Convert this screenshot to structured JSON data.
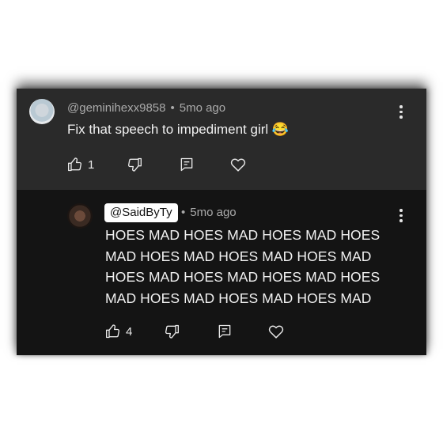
{
  "parent_comment": {
    "author": "@geminihexx9858",
    "separator": "•",
    "time": "5mo ago",
    "text": "Fix that speech to impediment girl 😂",
    "like_count": "1"
  },
  "reply": {
    "mention": "@SaidByTy",
    "separator": "•",
    "time": "5mo ago",
    "text": "HOES MAD HOES MAD HOES MAD HOES MAD HOES MAD HOES MAD HOES MAD HOES MAD HOES MAD HOES MAD HOES MAD HOES MAD HOES MAD HOES MAD",
    "like_count": "4"
  },
  "icons": [
    "like-icon",
    "dislike-icon",
    "reply-icon",
    "heart-icon",
    "more-vert-icon"
  ],
  "colors": {
    "parent_bg": "#2a2a2a",
    "reply_bg": "#141414",
    "text": "#f1f1f1",
    "meta": "#aaaaaa",
    "mention_bg": "#ffffff"
  }
}
